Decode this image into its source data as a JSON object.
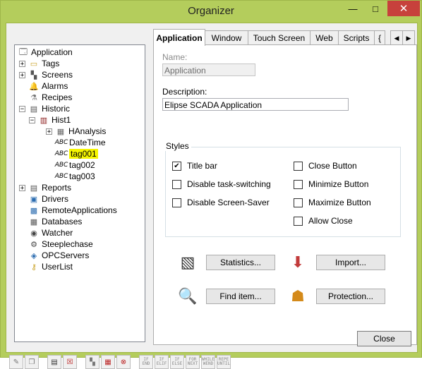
{
  "window": {
    "title": "Organizer",
    "minimize": "—",
    "maximize": "□",
    "close": "✕"
  },
  "tree": {
    "items": [
      {
        "label": "Application",
        "icon": "application-icon"
      },
      {
        "label": "Tags",
        "icon": "tags-icon"
      },
      {
        "label": "Screens",
        "icon": "screens-icon"
      },
      {
        "label": "Alarms",
        "icon": "alarm-bell-icon"
      },
      {
        "label": "Recipes",
        "icon": "recipes-icon"
      },
      {
        "label": "Historic",
        "icon": "historic-icon"
      },
      {
        "label": "Hist1",
        "icon": "hist-icon"
      },
      {
        "label": "HAnalysis",
        "icon": "analysis-icon"
      },
      {
        "label": "DateTime",
        "icon": "abc-icon"
      },
      {
        "label": "tag001",
        "icon": "abc-icon"
      },
      {
        "label": "tag002",
        "icon": "abc-icon"
      },
      {
        "label": "tag003",
        "icon": "abc-icon"
      },
      {
        "label": "Reports",
        "icon": "reports-icon"
      },
      {
        "label": "Drivers",
        "icon": "drivers-icon"
      },
      {
        "label": "RemoteApplications",
        "icon": "remote-icon"
      },
      {
        "label": "Databases",
        "icon": "database-icon"
      },
      {
        "label": "Watcher",
        "icon": "watcher-icon"
      },
      {
        "label": "Steeplechase",
        "icon": "steeplechase-icon"
      },
      {
        "label": "OPCServers",
        "icon": "opc-icon"
      },
      {
        "label": "UserList",
        "icon": "key-icon"
      }
    ],
    "abc_glyph": "ABC",
    "highlight_color": "#f5f500"
  },
  "tabs": [
    "Application",
    "Window",
    "Touch Screen",
    "Web",
    "Scripts",
    "{"
  ],
  "tab_nav": {
    "left": "◀",
    "right": "▶"
  },
  "form": {
    "name_label": "Name:",
    "name_value": "Application",
    "description_label": "Description:",
    "description_value": "Elipse SCADA Application",
    "styles_label": "Styles",
    "checkboxes": [
      {
        "label": "Title bar",
        "checked": true
      },
      {
        "label": "Disable task-switching",
        "checked": false
      },
      {
        "label": "Disable Screen-Saver",
        "checked": false
      },
      {
        "label": "Close Button",
        "checked": false
      },
      {
        "label": "Minimize Button",
        "checked": false
      },
      {
        "label": "Maximize Button",
        "checked": false
      },
      {
        "label": "Allow Close",
        "checked": false
      }
    ],
    "check_glyph": "✔"
  },
  "actions": {
    "statistics": "Statistics...",
    "import": "Import...",
    "find_item": "Find item...",
    "protection": "Protection..."
  },
  "toolbar": {
    "mini_labels": [
      "IF END",
      "IF ELIF",
      "IF ELSE",
      "FOR NEXT",
      "WHILE WEND",
      "REPE UNTIL"
    ]
  },
  "footer": {
    "close_label": "Close"
  }
}
